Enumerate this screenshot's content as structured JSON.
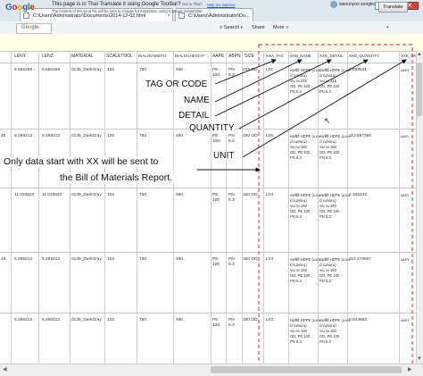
{
  "browser": {
    "tabs": [
      {
        "label": "C:\\Users\\Administrator\\Documents\\2014-12-02.html"
      },
      {
        "label": "C:\\Users\\Administrator\\Do..."
      }
    ],
    "user_name": "wanunyoo songtran",
    "window_controls": {
      "minimize": "–",
      "maximize": "□",
      "close": "✕"
    },
    "nav": {
      "search": "Search",
      "share": "Share",
      "more": "More",
      "more_arrow": "»",
      "dropdown_arrow": "▾"
    },
    "sign_in": "Sign In"
  },
  "translate_bar": {
    "logo": [
      "G",
      "o",
      "o",
      "g",
      "l",
      "e"
    ],
    "message": "This page is in Thai  Translate it using Google Toolbar?",
    "not_thai": "Not in Thai?",
    "sub_message": "The content of this local file will be sent to Google for translation using a secure connection.",
    "link": "Help me improve",
    "button": "Translate"
  },
  "table": {
    "headers": [
      "LENY",
      "LENZ",
      "MATERIAL",
      "SCALETOOL",
      "DIALOGWIDTH",
      "DIALOGHEIGHT",
      "AAPE",
      "ABPN",
      "SIZE",
      "XXA_TAG",
      "XXB_NAME",
      "XXC_DETAIL",
      "XXD_QUANTITY",
      "XXE_UNIT"
    ],
    "rows": [
      {
        "edge": "",
        "leny": "6.856268",
        "lenz": "6.856268",
        "material": "0135_DarkGray",
        "scale": "126",
        "width": "750",
        "height": "480",
        "aape": [
          "PE",
          "100"
        ],
        "abpn": [
          "PN",
          "6.3"
        ],
        "size": "225 OD",
        "tag": "L01",
        "name": [
          "ท่อพีอี HDPE (แบบ",
          "ม้วน/ท่อน)",
          "ขนาด 225",
          "OD, PE 100 ,",
          "PN 6.3"
        ],
        "detail": [
          "ท่อพีอี HDPE (แบบ",
          "ม้วน/ท่อน)",
          "ขนาด 225",
          "OD, PE 100 ,",
          "PN 6.3"
        ],
        "qty": "1.039641",
        "unit": "เมตร"
      },
      {
        "edge": "45",
        "leny": "6.299213",
        "lenz": "6.299213",
        "material": "0135_DarkGray",
        "scale": "126",
        "width": "750",
        "height": "480",
        "aape": [
          "PE",
          "100"
        ],
        "abpn": [
          "PN",
          "6.3"
        ],
        "size": "160 OD",
        "tag": "L05",
        "name": [
          "ท่อพีอี HDPE (แบบ",
          "ม้วน/ท่อน)",
          "ขนาด 160",
          "OD, PE 100 ,",
          "PN 6.3"
        ],
        "detail": [
          "ท่อพีอี HDPE (แบบ",
          "ม้วน/ท่อน)",
          "ขนาด 160",
          "OD, PE 100 ,",
          "PN 6.3"
        ],
        "qty": "113.597356",
        "unit": "เมตร"
      },
      {
        "edge": "",
        "leny": "11.023622",
        "lenz": "11.023622",
        "material": "0135_DarkGray",
        "scale": "126",
        "width": "750",
        "height": "480",
        "aape": [
          "PE",
          "100"
        ],
        "abpn": [
          "PN",
          "6.3"
        ],
        "size": "160 OD",
        "tag": "L03",
        "name": [
          "ท่อพีอี HDPE (แบบ",
          "ม้วน/ท่อน)",
          "ขนาด 160",
          "OD, PE 100 ,",
          "PN 6.3"
        ],
        "detail": [
          "ท่อพีอี HDPE (แบบ",
          "ม้วน/ท่อน)",
          "ขนาด 160",
          "OD, PE 100 ,",
          "PN 6.3"
        ],
        "qty": "2.345243",
        "unit": "เมตร"
      },
      {
        "edge": "18",
        "leny": "6.299213",
        "lenz": "6.299213",
        "material": "0135_DarkGray",
        "scale": "126",
        "width": "750",
        "height": "480",
        "aape": [
          "PE",
          "100"
        ],
        "abpn": [
          "PN",
          "6.3"
        ],
        "size": "160 OD",
        "tag": "L03",
        "name": [
          "ท่อพีอี HDPE (แบบ",
          "ม้วน/ท่อน)",
          "ขนาด 160",
          "OD, PE 100 ,",
          "PN 6.3"
        ],
        "detail": [
          "ท่อพีอี HDPE (แบบ",
          "ม้วน/ท่อน)",
          "ขนาด 160",
          "OD, PE 100 ,",
          "PN 6.3"
        ],
        "qty": "112.279567",
        "unit": "เมตร"
      },
      {
        "edge": "",
        "leny": "6.299213",
        "lenz": "6.299213",
        "material": "0135_DarkGray",
        "scale": "126",
        "width": "750",
        "height": "480",
        "aape": [
          "PE",
          "100"
        ],
        "abpn": [
          "PN",
          "6.3"
        ],
        "size": "160 OD",
        "tag": "L03",
        "name": [
          "ท่อพีอี HDPE (แบบ",
          "ม้วน/ท่อน)",
          "ขนาด 160",
          "OD, PE 100 ,",
          "PN 6.3"
        ],
        "detail": [
          "ท่อพีอี HDPE (แบบ",
          "ม้วน/ท่อน)",
          "ขนาด 160",
          "OD, PE 100 ,",
          "PN 6.3"
        ],
        "qty": "0.843863",
        "unit": "เมตร"
      }
    ]
  },
  "annotations": {
    "tag": "TAG OR CODE",
    "name": "NAME",
    "detail": "DETAIL",
    "quantity": "QUANTITY",
    "unit": "UNIT",
    "note_line1": "Only data start with XX will be sent to",
    "note_line2": "the Bill of Materials Report."
  },
  "scrollbar": {
    "left": "◀",
    "right": "▶",
    "up": "▲",
    "down": "▼"
  },
  "colors": {
    "highlight_border": "#e05050",
    "arrow": "#111111"
  }
}
